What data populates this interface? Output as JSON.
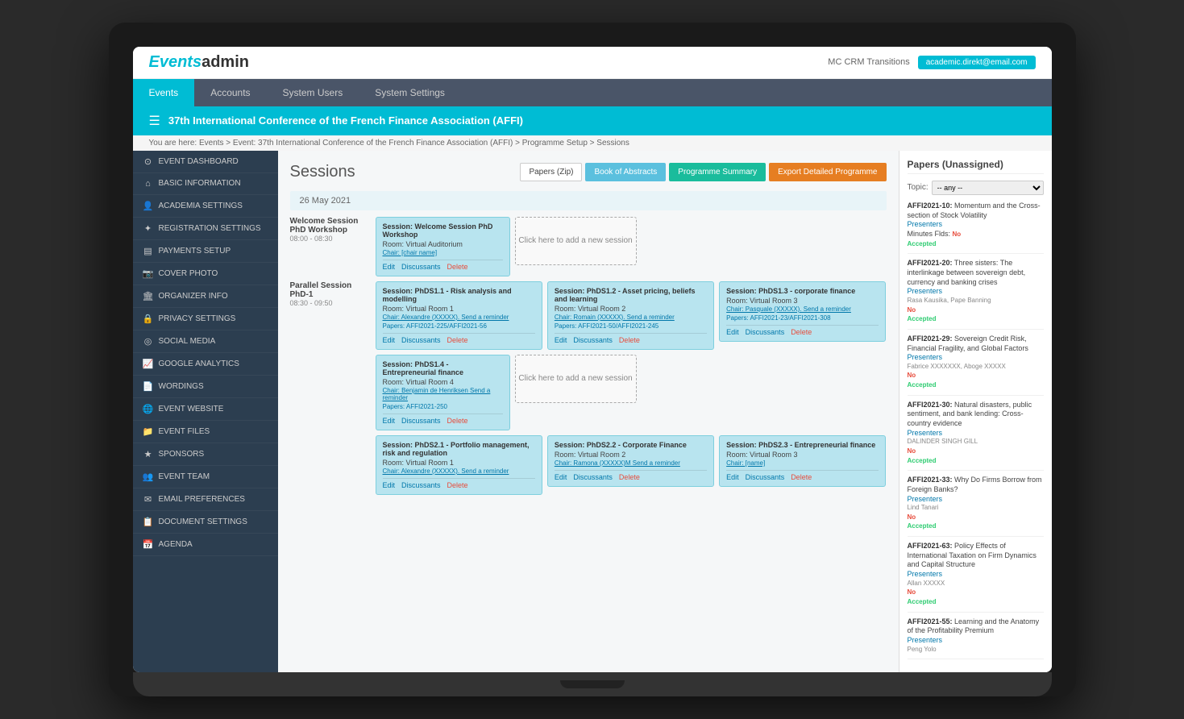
{
  "app": {
    "logo_prefix": "Events",
    "logo_suffix": "admin",
    "user_name": "MC CRM Transitions",
    "user_email": "academic.direkt@email.com"
  },
  "nav": {
    "items": [
      {
        "label": "Events",
        "active": true
      },
      {
        "label": "Accounts",
        "active": false
      },
      {
        "label": "System Users",
        "active": false
      },
      {
        "label": "System Settings",
        "active": false
      }
    ]
  },
  "event_banner": {
    "title": "37th International Conference of the French Finance Association (AFFI)"
  },
  "breadcrumb": "You are here: Events > Event: 37th International Conference of the French Finance Association (AFFI) > Programme Setup > Sessions",
  "sidebar": {
    "items": [
      {
        "icon": "⊙",
        "label": "EVENT DASHBOARD"
      },
      {
        "icon": "⌂",
        "label": "BASIC INFORMATION"
      },
      {
        "icon": "👤",
        "label": "ACADEMIA SETTINGS"
      },
      {
        "icon": "✦",
        "label": "REGISTRATION SETTINGS"
      },
      {
        "icon": "▤",
        "label": "PAYMENTS SETUP"
      },
      {
        "icon": "📷",
        "label": "COVER PHOTO"
      },
      {
        "icon": "🏛",
        "label": "ORGANIZER INFO"
      },
      {
        "icon": "🔒",
        "label": "PRIVACY SETTINGS"
      },
      {
        "icon": "◎",
        "label": "SOCIAL MEDIA"
      },
      {
        "icon": "📈",
        "label": "GOOGLE ANALYTICS"
      },
      {
        "icon": "📄",
        "label": "WORDINGS"
      },
      {
        "icon": "🌐",
        "label": "EVENT WEBSITE"
      },
      {
        "icon": "📁",
        "label": "EVENT FILES"
      },
      {
        "icon": "★",
        "label": "SPONSORS"
      },
      {
        "icon": "👥",
        "label": "EVENT TEAM"
      },
      {
        "icon": "✉",
        "label": "EMAIL PREFERENCES"
      },
      {
        "icon": "📋",
        "label": "DOCUMENT SETTINGS"
      },
      {
        "icon": "📅",
        "label": "AGENDA"
      }
    ]
  },
  "sessions": {
    "title": "Sessions",
    "buttons": [
      {
        "label": "Papers (Zip)",
        "style": "default"
      },
      {
        "label": "Book of Abstracts",
        "style": "primary"
      },
      {
        "label": "Programme Summary",
        "style": "teal"
      },
      {
        "label": "Export Detailed Programme",
        "style": "orange"
      }
    ],
    "date_groups": [
      {
        "date": "26 May 2021",
        "rows": [
          {
            "label": "Welcome Session PhD Workshop",
            "time": "08:00 - 08:30",
            "sessions": [
              {
                "type": "filled",
                "title": "Session: Welcome Session PhD Workshop",
                "room": "Room: Virtual Auditorium",
                "chair": "Chair: [chair name]",
                "papers": null,
                "actions": [
                  "Edit",
                  "Discussants",
                  "Delete"
                ]
              },
              {
                "type": "add",
                "label": "Click here to add a new session"
              },
              {
                "type": "empty"
              },
              {
                "type": "empty"
              }
            ]
          },
          {
            "label": "Parallel Session PhD-1",
            "time": "08:30 - 09:50",
            "sessions": [
              {
                "type": "filled",
                "title": "Session: PhDS1.1 - Risk analysis and modelling",
                "room": "Room: Virtual Room 1",
                "chair": "Chair: Alexandre (XXXXX). Send a reminder",
                "papers": "Papers: AFFI2021-225/AFFI2021-56",
                "actions": [
                  "Edit",
                  "Discussants",
                  "Delete"
                ]
              },
              {
                "type": "filled",
                "title": "Session: PhDS1.2 - Asset pricing, beliefs and learning",
                "room": "Room: Virtual Room 2",
                "chair": "Chair: Romain (XXXXX). Send a reminder",
                "papers": "Papers: AFFI2021-50/AFFI2021-245",
                "actions": [
                  "Edit",
                  "Discussants",
                  "Delete"
                ]
              },
              {
                "type": "filled",
                "title": "Session: PhDS1.3 - corporate finance",
                "room": "Room: Virtual Room 3",
                "chair": "Chair: Pasquale (XXXXX). Send a reminder",
                "papers": "Papers: AFFI2021-23/AFFI2021-308",
                "actions": [
                  "Edit",
                  "Discussants",
                  "Delete"
                ]
              }
            ]
          },
          {
            "label": "Parallel Session PhD-1",
            "time": "08:30 - 09:50",
            "sessions": [
              {
                "type": "filled",
                "title": "Session: PhDS1.4 - Entrepreneurial finance",
                "room": "Room: Virtual Room 4",
                "chair": "Chair: Benjamin de Henriksen Send a reminder",
                "papers": "Papers: AFFI2021-250",
                "actions": [
                  "Edit",
                  "Discussants",
                  "Delete"
                ]
              },
              {
                "type": "add",
                "label": "Click here to add a new session"
              },
              {
                "type": "empty"
              },
              {
                "type": "empty"
              }
            ]
          },
          {
            "label": "",
            "time": "",
            "sessions": [
              {
                "type": "filled",
                "title": "Session: PhDS2.1 - Portfolio management, risk and regulation",
                "room": "Room: Virtual Room 1",
                "chair": "Chair: Alexandre (XXXXX). Send a reminder",
                "papers": null,
                "actions": [
                  "Edit",
                  "Discussants",
                  "Delete"
                ]
              },
              {
                "type": "filled",
                "title": "Session: PhDS2.2 - Corporate Finance",
                "room": "Room: Virtual Room 2",
                "chair": "Chair: Ramona (XXXXX)M Send a reminder",
                "papers": null,
                "actions": [
                  "Edit",
                  "Discussants",
                  "Delete"
                ]
              },
              {
                "type": "filled",
                "title": "Session: PhDS2.3 - Entrepreneurial finance",
                "room": "Room: Virtual Room 3",
                "chair": "Chair: [name]",
                "papers": null,
                "actions": [
                  "Edit",
                  "Discussants",
                  "Delete"
                ]
              }
            ]
          }
        ]
      }
    ]
  },
  "right_panel": {
    "title": "Papers (Unassigned)",
    "topic_label": "Topic:",
    "topic_default": "-- any --",
    "papers": [
      {
        "id": "AFFI2021-10:",
        "title": "Momentum and the Cross-section of Stock Volatility",
        "presenters_label": "Presenters",
        "minutes_label": "Minutes Flds:",
        "minutes_val": "No",
        "status": "Accepted"
      },
      {
        "id": "AFFI2021-20:",
        "title": "Three sisters: The interlinkage between sovereign debt, currency and banking crises",
        "presenters_label": "Presenters",
        "author": "Rasa Kausika, Pape Banning",
        "minutes_val": "No",
        "status": "Accepted"
      },
      {
        "id": "AFFI2021-29:",
        "title": "Sovereign Credit Risk, Financial Fragility, and Global Factors",
        "presenters_label": "Presenters",
        "author": "Fabrice XXXXXXX, Aboge XXXXX",
        "minutes_val": "No",
        "status": "Accepted"
      },
      {
        "id": "AFFI2021-30:",
        "title": "Natural disasters, public sentiment, and bank lending: Cross-country evidence",
        "presenters_label": "Presenters",
        "author": "DALINDER SINGH GILL",
        "minutes_val": "No",
        "status": "Accepted"
      },
      {
        "id": "AFFI2021-33:",
        "title": "Why Do Firms Borrow from Foreign Banks?",
        "presenters_label": "Presenters",
        "author": "Lind Tanari",
        "minutes_val": "No",
        "status": "Accepted"
      },
      {
        "id": "AFFI2021-63:",
        "title": "Policy Effects of International Taxation on Firm Dynamics and Capital Structure",
        "presenters_label": "Presenters",
        "author": "Allan XXXXX",
        "minutes_val": "No",
        "status": "Accepted"
      },
      {
        "id": "AFFI2021-55:",
        "title": "Learning and the Anatomy of the Profitability Premium",
        "presenters_label": "Presenters",
        "author": "Peng Yolo",
        "status": "—"
      }
    ]
  }
}
